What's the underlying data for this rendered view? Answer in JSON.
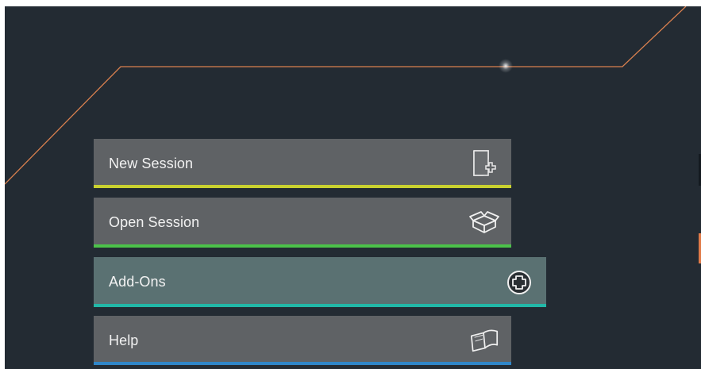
{
  "menu": {
    "items": [
      {
        "label": "New Session",
        "icon": "new-document-icon",
        "accent": "#c9d12f"
      },
      {
        "label": "Open Session",
        "icon": "open-box-icon",
        "accent": "#4cc24a"
      },
      {
        "label": "Add-Ons",
        "icon": "plus-circle-icon",
        "accent": "#22b8a8",
        "highlighted": true
      },
      {
        "label": "Help",
        "icon": "book-icon",
        "accent": "#2f86c8"
      }
    ]
  },
  "colors": {
    "background": "#232b33",
    "button": "#5f6265",
    "button_highlight": "#5a7172",
    "decor_line": "#d9804f"
  }
}
